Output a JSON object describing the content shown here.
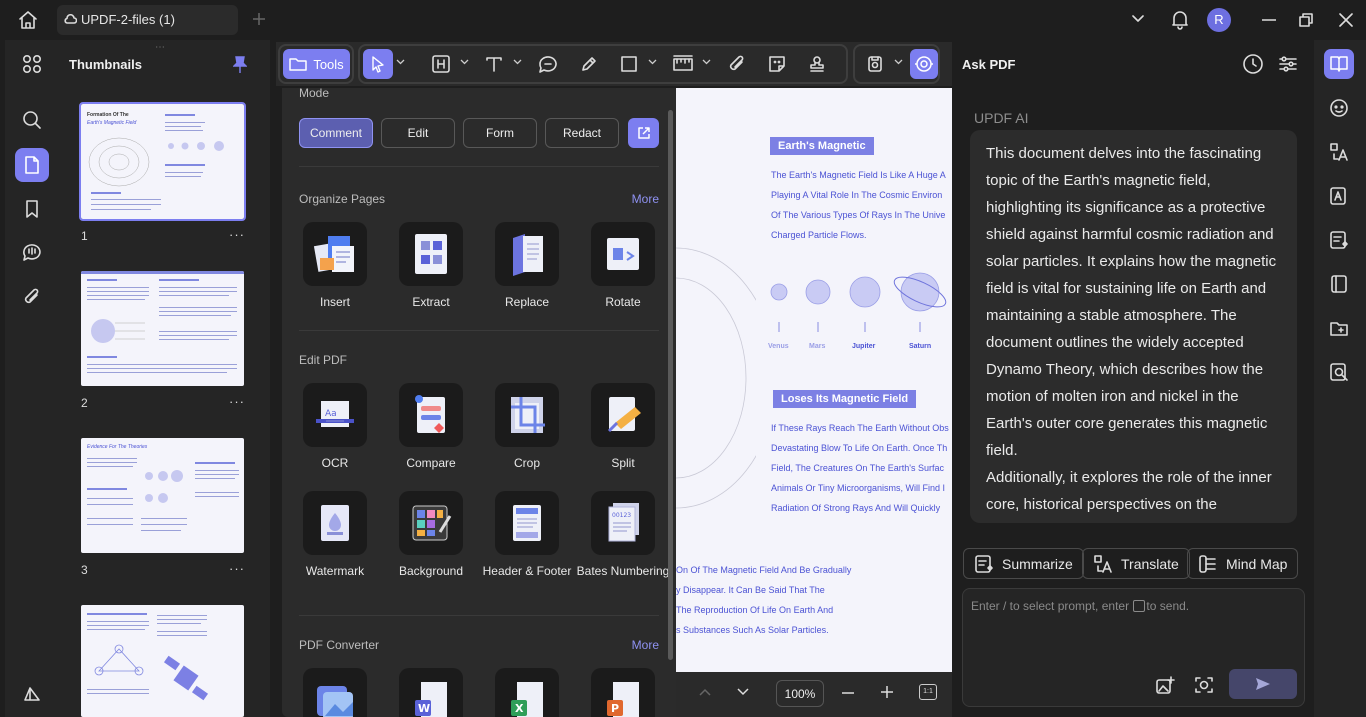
{
  "titlebar": {
    "file_tab": "UPDF-2-files (1)",
    "avatar_initial": "R"
  },
  "thumbnails": {
    "title": "Thumbnails",
    "pages": [
      {
        "number": "1",
        "heading": "Formation Of The",
        "heading2": "Earth's Magnetic Field"
      },
      {
        "number": "2"
      },
      {
        "number": "3",
        "heading": "Evidence For The Theories"
      },
      {
        "number": ""
      }
    ],
    "more_label": "···"
  },
  "toolbar": {
    "tools_label": "Tools"
  },
  "tools_panel": {
    "mode_label": "Mode",
    "modes": [
      "Comment",
      "Edit",
      "Form",
      "Redact"
    ],
    "active_mode": "Comment",
    "organize": {
      "title": "Organize Pages",
      "more": "More",
      "items": [
        "Insert",
        "Extract",
        "Replace",
        "Rotate"
      ]
    },
    "edit": {
      "title": "Edit PDF",
      "items": [
        "OCR",
        "Compare",
        "Crop",
        "Split",
        "Watermark",
        "Background",
        "Header & Footer",
        "Bates Numbering"
      ]
    },
    "converter": {
      "title": "PDF Converter",
      "more": "More"
    }
  },
  "document": {
    "heading1": "Earth's Magnetic",
    "para1": [
      "The Earth's Magnetic Field Is Like A Huge A",
      "Playing A Vital Role In The Cosmic Environ",
      "Of The Various Types Of Rays In The Unive",
      "Charged Particle Flows."
    ],
    "planets": [
      "Venus",
      "Mars",
      "Jupiter",
      "Saturn"
    ],
    "heading2": "Loses Its Magnetic Field",
    "para2": [
      "If These Rays Reach The Earth Without Obs",
      "Devastating Blow To Life On Earth. Once Th",
      "Field, The Creatures On The Earth's Surfac",
      "Animals Or Tiny Microorganisms, Will Find I",
      "Radiation Of Strong Rays And Will Quickly"
    ],
    "para3": [
      "On Of The Magnetic Field And Be Gradually",
      "y Disappear. It Can Be Said That The",
      "The Reproduction Of Life On Earth And",
      "s Substances Such As Solar Particles."
    ],
    "zoom": "100%",
    "fit_label": "1:1"
  },
  "ai_panel": {
    "title": "Ask PDF",
    "sender": "UPDF AI",
    "message": "This document delves into the fascinating topic of the Earth's magnetic field, highlighting its significance as a protective shield against harmful cosmic radiation and solar particles. It explains how the magnetic field is vital for sustaining life on Earth and maintaining a stable atmosphere. The document outlines the widely accepted Dynamo Theory, which describes how the motion of molten iron and nickel in the Earth's outer core generates this magnetic field.",
    "message2": "Additionally, it explores the role of the inner core, historical perspectives on the",
    "chips": [
      "Summarize",
      "Translate",
      "Mind Map"
    ],
    "prompt_placeholder_a": "Enter / to select prompt, enter",
    "prompt_placeholder_b": "to send."
  },
  "colors": {
    "accent": "#7c7ef0",
    "doc_text": "#4b52d4"
  }
}
